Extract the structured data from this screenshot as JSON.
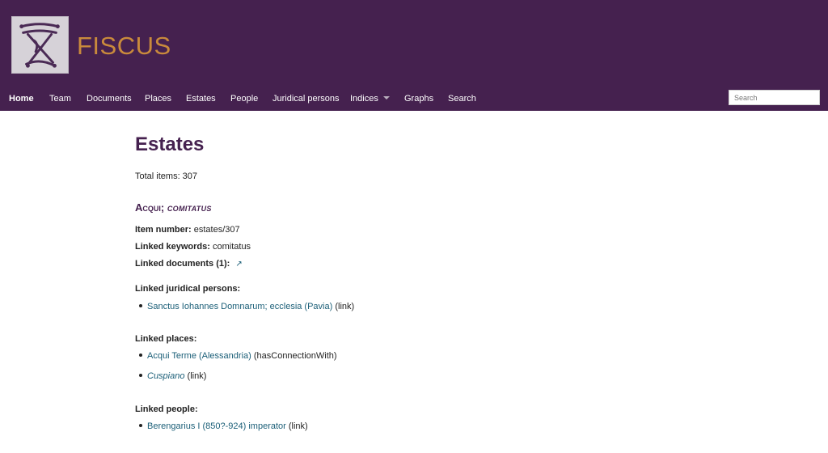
{
  "site": {
    "title": "FISCUS"
  },
  "nav": {
    "items": [
      "Home",
      "Team",
      "Documents",
      "Places",
      "Estates",
      "People",
      "Juridical persons",
      "Indices",
      "Graphs",
      "Search"
    ]
  },
  "search": {
    "placeholder": "Search"
  },
  "page": {
    "title": "Estates",
    "total": "Total items: 307"
  },
  "item": {
    "name": "Acqui;",
    "type": "comitatus",
    "item_number_label": "Item number:",
    "item_number": "estates/307",
    "keywords_label": "Linked keywords:",
    "keywords": "comitatus",
    "documents_label": "Linked documents (1):",
    "juridical_label": "Linked juridical persons:",
    "juridical": [
      {
        "name": "Sanctus Iohannes Domnarum; ecclesia (Pavia)",
        "rel": "(link)"
      }
    ],
    "places_label": "Linked places:",
    "places": [
      {
        "name": "Acqui Terme (Alessandria)",
        "rel": "(hasConnectionWith)"
      },
      {
        "name": "Cuspiano",
        "rel": "(link)"
      }
    ],
    "people_label": "Linked people:",
    "people": [
      {
        "name": "Berengarius I (850?-924) imperator",
        "rel": "(link)"
      }
    ]
  },
  "colors": {
    "header_bg": "#45214f",
    "brand": "#c98a3c",
    "link": "#1a5e77",
    "title": "#45214f"
  },
  "icons": {
    "logo": "fiscus-chair-logo",
    "external": "external-link-icon",
    "dropdown": "caret-down-icon"
  }
}
